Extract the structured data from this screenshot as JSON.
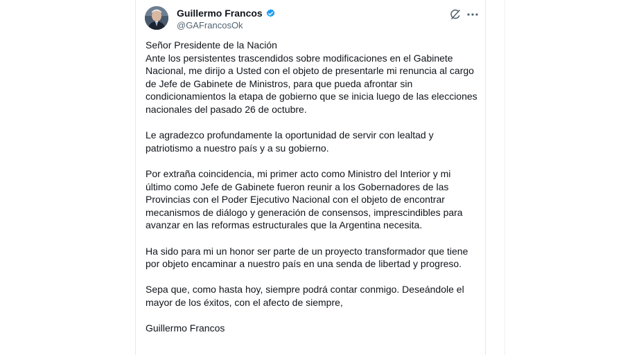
{
  "author": {
    "display_name": "Guillermo Francos",
    "handle": "@GAFrancosOk",
    "verified": true
  },
  "icons": {
    "avatar": "avatar-photo",
    "verified": "verified-badge-icon",
    "grok": "grok-icon",
    "more": "more-options-icon"
  },
  "colors": {
    "verified_badge": "#1d9bf0",
    "text_primary": "#0f1419",
    "text_secondary": "#536471"
  },
  "tweet": {
    "greeting": "Señor Presidente de la Nación",
    "paragraphs": [
      "Ante los persistentes trascendidos sobre modificaciones en el Gabinete Nacional, me dirijo a Usted con el objeto de presentarle mi renuncia al cargo de Jefe de Gabinete de Ministros, para que pueda afrontar sin condicionamientos la etapa de gobierno que se inicia luego de las elecciones nacionales del pasado 26 de octubre.",
      "Le agradezco profundamente la oportunidad de servir con lealtad y patriotismo a nuestro país y a su gobierno.",
      "Por extraña coincidencia, mi primer acto como Ministro del Interior y mi último como Jefe de Gabinete fueron reunir a los Gobernadores de las Provincias con el Poder Ejecutivo Nacional con el objeto de encontrar mecanismos de diálogo y generación de consensos, imprescindibles para avanzar en las reformas estructurales que la Argentina necesita.",
      "Ha sido para mi un honor ser parte de un proyecto transformador que tiene por objeto encaminar a nuestro país en una senda de libertad y progreso.",
      "Sepa que, como hasta hoy, siempre podrá contar conmigo. Deseándole el mayor de los éxitos, con el afecto de siempre,"
    ],
    "signature": "Guillermo Francos"
  }
}
